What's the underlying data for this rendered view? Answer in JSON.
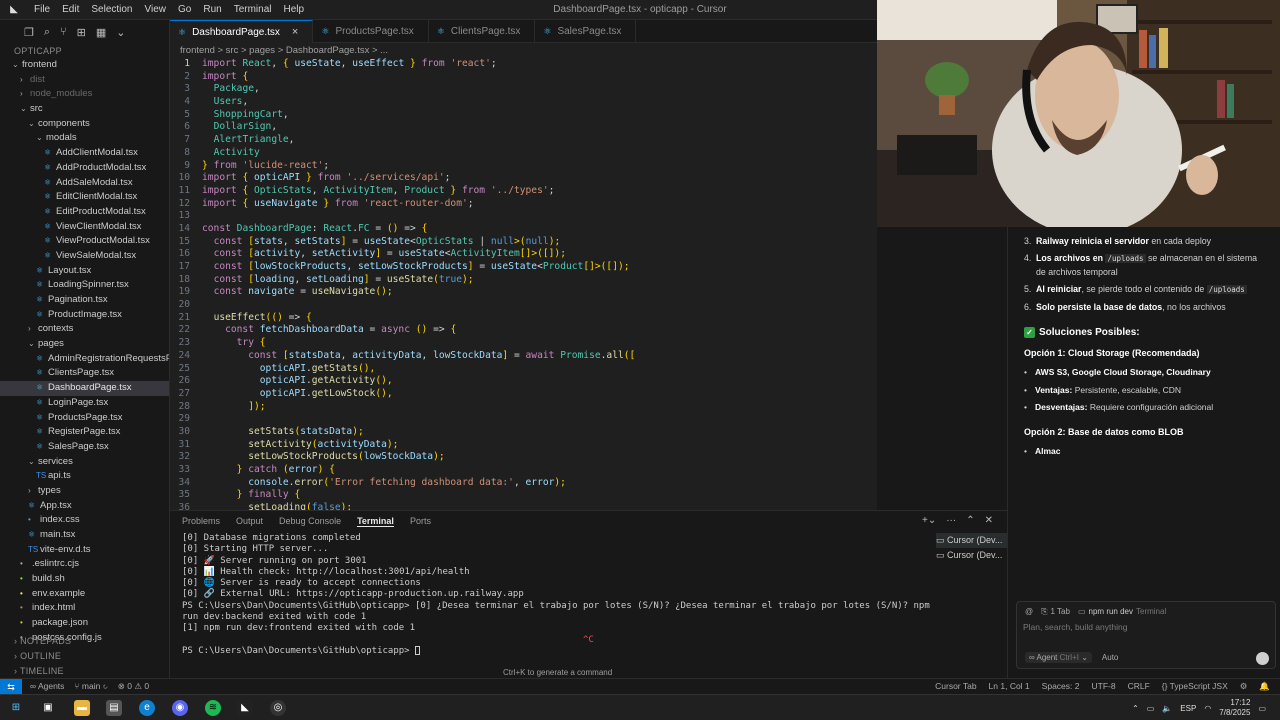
{
  "titlebar": {
    "menu": [
      "File",
      "Edit",
      "Selection",
      "View",
      "Go",
      "Run",
      "Terminal",
      "Help"
    ],
    "window_title": "DashboardPage.tsx - opticapp - Cursor"
  },
  "sidebar": {
    "root": "OPTICAPP",
    "items": [
      {
        "label": "frontend",
        "indent": 1,
        "kind": "folder-open"
      },
      {
        "label": "dist",
        "indent": 2,
        "kind": "folder",
        "dim": true
      },
      {
        "label": "node_modules",
        "indent": 2,
        "kind": "folder",
        "dim": true
      },
      {
        "label": "src",
        "indent": 2,
        "kind": "folder-open"
      },
      {
        "label": "components",
        "indent": 3,
        "kind": "folder-open"
      },
      {
        "label": "modals",
        "indent": 4,
        "kind": "folder-open"
      },
      {
        "label": "AddClientModal.tsx",
        "indent": 5,
        "kind": "tsx"
      },
      {
        "label": "AddProductModal.tsx",
        "indent": 5,
        "kind": "tsx"
      },
      {
        "label": "AddSaleModal.tsx",
        "indent": 5,
        "kind": "tsx"
      },
      {
        "label": "EditClientModal.tsx",
        "indent": 5,
        "kind": "tsx"
      },
      {
        "label": "EditProductModal.tsx",
        "indent": 5,
        "kind": "tsx"
      },
      {
        "label": "ViewClientModal.tsx",
        "indent": 5,
        "kind": "tsx"
      },
      {
        "label": "ViewProductModal.tsx",
        "indent": 5,
        "kind": "tsx"
      },
      {
        "label": "ViewSaleModal.tsx",
        "indent": 5,
        "kind": "tsx"
      },
      {
        "label": "Layout.tsx",
        "indent": 4,
        "kind": "tsx"
      },
      {
        "label": "LoadingSpinner.tsx",
        "indent": 4,
        "kind": "tsx"
      },
      {
        "label": "Pagination.tsx",
        "indent": 4,
        "kind": "tsx"
      },
      {
        "label": "ProductImage.tsx",
        "indent": 4,
        "kind": "tsx"
      },
      {
        "label": "contexts",
        "indent": 3,
        "kind": "folder"
      },
      {
        "label": "pages",
        "indent": 3,
        "kind": "folder-open"
      },
      {
        "label": "AdminRegistrationRequestsPag...",
        "indent": 4,
        "kind": "tsx"
      },
      {
        "label": "ClientsPage.tsx",
        "indent": 4,
        "kind": "tsx"
      },
      {
        "label": "DashboardPage.tsx",
        "indent": 4,
        "kind": "tsx",
        "active": true
      },
      {
        "label": "LoginPage.tsx",
        "indent": 4,
        "kind": "tsx"
      },
      {
        "label": "ProductsPage.tsx",
        "indent": 4,
        "kind": "tsx"
      },
      {
        "label": "RegisterPage.tsx",
        "indent": 4,
        "kind": "tsx"
      },
      {
        "label": "SalesPage.tsx",
        "indent": 4,
        "kind": "tsx"
      },
      {
        "label": "services",
        "indent": 3,
        "kind": "folder-open"
      },
      {
        "label": "api.ts",
        "indent": 4,
        "kind": "ts"
      },
      {
        "label": "types",
        "indent": 3,
        "kind": "folder"
      },
      {
        "label": "App.tsx",
        "indent": 3,
        "kind": "tsx"
      },
      {
        "label": "index.css",
        "indent": 3,
        "kind": "css"
      },
      {
        "label": "main.tsx",
        "indent": 3,
        "kind": "tsx"
      },
      {
        "label": "vite-env.d.ts",
        "indent": 3,
        "kind": "ts"
      },
      {
        "label": ".eslintrc.cjs",
        "indent": 2,
        "kind": "js"
      },
      {
        "label": "build.sh",
        "indent": 2,
        "kind": "sh"
      },
      {
        "label": "env.example",
        "indent": 2,
        "kind": "env"
      },
      {
        "label": "index.html",
        "indent": 2,
        "kind": "html"
      },
      {
        "label": "package.json",
        "indent": 2,
        "kind": "json"
      },
      {
        "label": "postcss.config.js",
        "indent": 2,
        "kind": "js"
      }
    ],
    "sections": [
      "NOTEPADS",
      "OUTLINE",
      "TIMELINE"
    ]
  },
  "tabs": [
    {
      "label": "DashboardPage.tsx",
      "active": true
    },
    {
      "label": "ProductsPage.tsx",
      "active": false
    },
    {
      "label": "ClientsPage.tsx",
      "active": false
    },
    {
      "label": "SalesPage.tsx",
      "active": false
    }
  ],
  "breadcrumb": "frontend > src > pages > DashboardPage.tsx > ...",
  "editor": {
    "current_line": 1,
    "lines": [
      "import React, { useState, useEffect } from 'react';",
      "import {",
      "  Package,",
      "  Users,",
      "  ShoppingCart,",
      "  DollarSign,",
      "  AlertTriangle,",
      "  Activity",
      "} from 'lucide-react';",
      "import { opticAPI } from '../services/api';",
      "import { OpticStats, ActivityItem, Product } from '../types';",
      "import { useNavigate } from 'react-router-dom';",
      "",
      "const DashboardPage: React.FC = () => {",
      "  const [stats, setStats] = useState<OpticStats | null>(null);",
      "  const [activity, setActivity] = useState<ActivityItem[]>([]);",
      "  const [lowStockProducts, setLowStockProducts] = useState<Product[]>([]);",
      "  const [loading, setLoading] = useState(true);",
      "  const navigate = useNavigate();",
      "",
      "  useEffect(() => {",
      "    const fetchDashboardData = async () => {",
      "      try {",
      "        const [statsData, activityData, lowStockData] = await Promise.all([",
      "          opticAPI.getStats(),",
      "          opticAPI.getActivity(),",
      "          opticAPI.getLowStock(),",
      "        ]);",
      "",
      "        setStats(statsData);",
      "        setActivity(activityData);",
      "        setLowStockProducts(lowStockData);",
      "      } catch (error) {",
      "        console.error('Error fetching dashboard data:', error);",
      "      } finally {",
      "        setLoading(false);"
    ]
  },
  "panel": {
    "tabs": [
      "Problems",
      "Output",
      "Debug Console",
      "Terminal",
      "Ports"
    ],
    "active_tab": "Terminal",
    "terminal_lines": [
      "[0] Database migrations completed",
      "[0] Starting HTTP server...",
      "[0] 🚀 Server running on port 3001",
      "[0] 📊 Health check: http://localhost:3001/api/health",
      "[0] 🌐 Server is ready to accept connections",
      "[0] 🔗 External URL: https://opticapp-production.up.railway.app",
      "PS C:\\Users\\Dan\\Documents\\GitHub\\opticapp> [0] ¿Desea terminar el trabajo por lotes (S/N)? ¿Desea terminar el trabajo por lotes (S/N)? npm run dev:backend exited with code 1",
      "[1] npm run dev:frontend exited with code 1",
      "                                                                          ^C",
      "PS C:\\Users\\Dan\\Documents\\GitHub\\opticapp> "
    ],
    "hint": "Ctrl+K to generate a command",
    "terminal_list": [
      "Cursor (Dev...",
      "Cursor (Dev..."
    ]
  },
  "chat": {
    "ordered": [
      {
        "num": "3.",
        "bold": "Railway reinicia el servidor",
        "rest": " en cada deploy"
      },
      {
        "num": "4.",
        "bold": "Los archivos en",
        "code": "/uploads",
        "rest": " se almacenan en el sistema de archivos temporal"
      },
      {
        "num": "5.",
        "bold": "Al reiniciar",
        "rest": ", se pierde todo el contenido de ",
        "code2": "/uploads"
      },
      {
        "num": "6.",
        "bold": "Solo persiste la base de datos",
        "rest": ", no los archivos"
      }
    ],
    "solutions_title": "Soluciones Posibles:",
    "option1_title": "Opción 1: Cloud Storage (Recomendada)",
    "option1_items": [
      {
        "bold": "AWS S3, Google Cloud Storage, Cloudinary",
        "rest": ""
      },
      {
        "bold": "Ventajas:",
        "rest": " Persistente, escalable, CDN"
      },
      {
        "bold": "Desventajas:",
        "rest": " Requiere configuración adicional"
      }
    ],
    "option2_title": "Opción 2: Base de datos como BLOB",
    "option2_items": [
      {
        "bold": "Almac",
        "rest": ""
      }
    ],
    "input": {
      "ctx_tab": "1 Tab",
      "ctx_terminal": "npm run dev",
      "ctx_terminal_suffix": "Terminal",
      "placeholder": "Plan, search, build anything",
      "agent_label": "Agent",
      "agent_shortcut": "Ctrl+I",
      "model": "Auto"
    }
  },
  "statusbar": {
    "agents": "Agents",
    "branch": "main",
    "problems": "⊗ 0 ⚠ 0",
    "right": [
      "Cursor Tab",
      "Ln 1, Col 1",
      "Spaces: 2",
      "UTF-8",
      "CRLF",
      "{} TypeScript JSX"
    ]
  },
  "taskbar": {
    "language": "ESP",
    "time": "17:12",
    "date": "7/8/2025"
  }
}
